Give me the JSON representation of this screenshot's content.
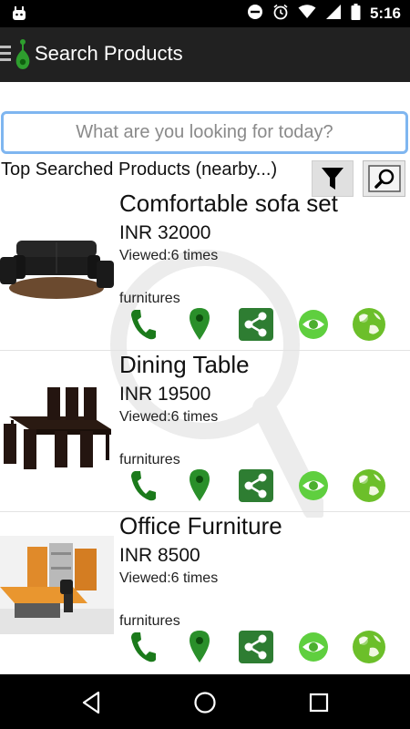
{
  "status_bar": {
    "time": "5:16"
  },
  "app_bar": {
    "title": "Search Products"
  },
  "search": {
    "placeholder": "What are you looking for today?"
  },
  "section": {
    "title": "Top Searched Products (nearby...)"
  },
  "products": [
    {
      "name": "Comfortable sofa set",
      "price": "INR 32000",
      "viewed": "Viewed:6 times",
      "category": "furnitures"
    },
    {
      "name": "Dining Table",
      "price": "INR 19500",
      "viewed": "Viewed:6 times",
      "category": "furnitures"
    },
    {
      "name": "Office Furniture",
      "price": "INR 8500",
      "viewed": "Viewed:6 times",
      "category": "furnitures"
    }
  ],
  "colors": {
    "app_bar": "#212121",
    "accent_green": "#2e7d32",
    "search_border": "#7fb6f0"
  },
  "icons": [
    "menu-icon",
    "app-logo-icon",
    "filter-icon",
    "search-icon",
    "phone-icon",
    "location-pin-icon",
    "share-icon",
    "eye-icon",
    "globe-icon",
    "back-icon",
    "home-icon",
    "recents-icon"
  ]
}
